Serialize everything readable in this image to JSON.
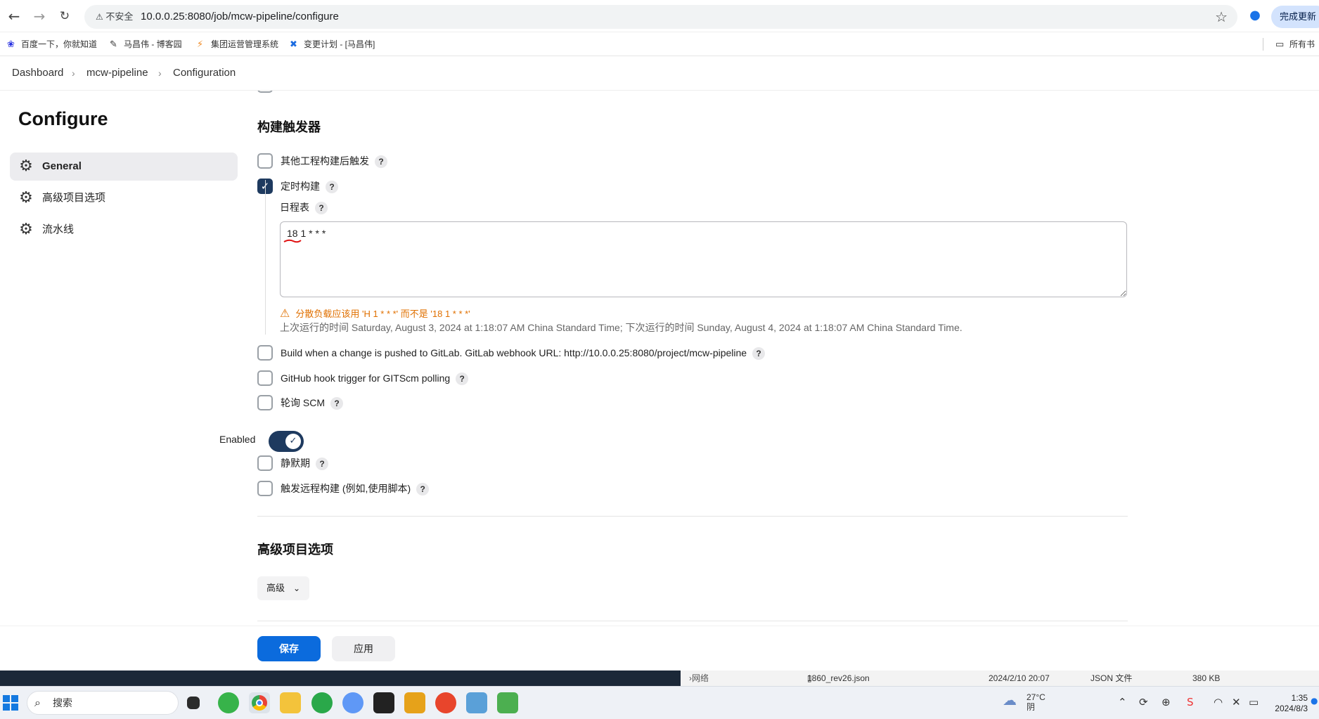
{
  "browser": {
    "insecure_label": "不安全",
    "url": "10.0.0.25:8080/job/mcw-pipeline/configure",
    "update_label": "完成更新",
    "bookmarks": [
      "百度一下，你就知道",
      "马昌伟 - 博客园",
      "集团运营管理系统",
      "变更计划 - [马昌伟]"
    ],
    "all_bookmarks_label": "所有书"
  },
  "breadcrumb": [
    "Dashboard",
    "mcw-pipeline",
    "Configuration"
  ],
  "sidebar": {
    "title": "Configure",
    "items": [
      {
        "label": "General",
        "active": true
      },
      {
        "label": "高级项目选项",
        "active": false
      },
      {
        "label": "流水线",
        "active": false
      }
    ]
  },
  "triggers": {
    "title": "构建触发器",
    "other_project": {
      "label": "其他工程构建后触发",
      "checked": false
    },
    "periodic": {
      "label": "定时构建",
      "checked": true
    },
    "schedule": {
      "label": "日程表",
      "value": "18 1 * * *",
      "warning": "分散负载应该用 'H 1 * * *' 而不是 '18 1 * * *'",
      "info": "上次运行的时间 Saturday, August 3, 2024 at 1:18:07 AM China Standard Time; 下次运行的时间 Sunday, August 4, 2024 at 1:18:07 AM China Standard Time."
    },
    "gitlab": {
      "label": "Build when a change is pushed to GitLab. GitLab webhook URL: http://10.0.0.25:8080/project/mcw-pipeline",
      "checked": false
    },
    "github": {
      "label": "GitHub hook trigger for GITScm polling",
      "checked": false
    },
    "scm": {
      "label": "轮询 SCM",
      "checked": false
    },
    "enabled_label": "Enabled",
    "enabled": true,
    "quiet": {
      "label": "静默期",
      "checked": false
    },
    "remote": {
      "label": "触发远程构建 (例如,使用脚本)",
      "checked": false
    }
  },
  "advanced": {
    "title": "高级项目选项",
    "button_label": "高级"
  },
  "actions": {
    "save_label": "保存",
    "apply_label": "应用"
  },
  "background_window": {
    "file_name": "1860_rev26.json",
    "file_date": "2024/2/10 20:07",
    "file_type": "JSON 文件",
    "file_size": "380 KB",
    "tree_label": "网络"
  },
  "taskbar": {
    "search_placeholder": "搜索",
    "weather_temp": "27°C",
    "weather_desc": "阴",
    "time": "1:35",
    "date": "2024/8/3"
  },
  "colors": {
    "accent": "#1e3a5f",
    "primary_button": "#0b6bdd",
    "warning": "#e07000"
  }
}
